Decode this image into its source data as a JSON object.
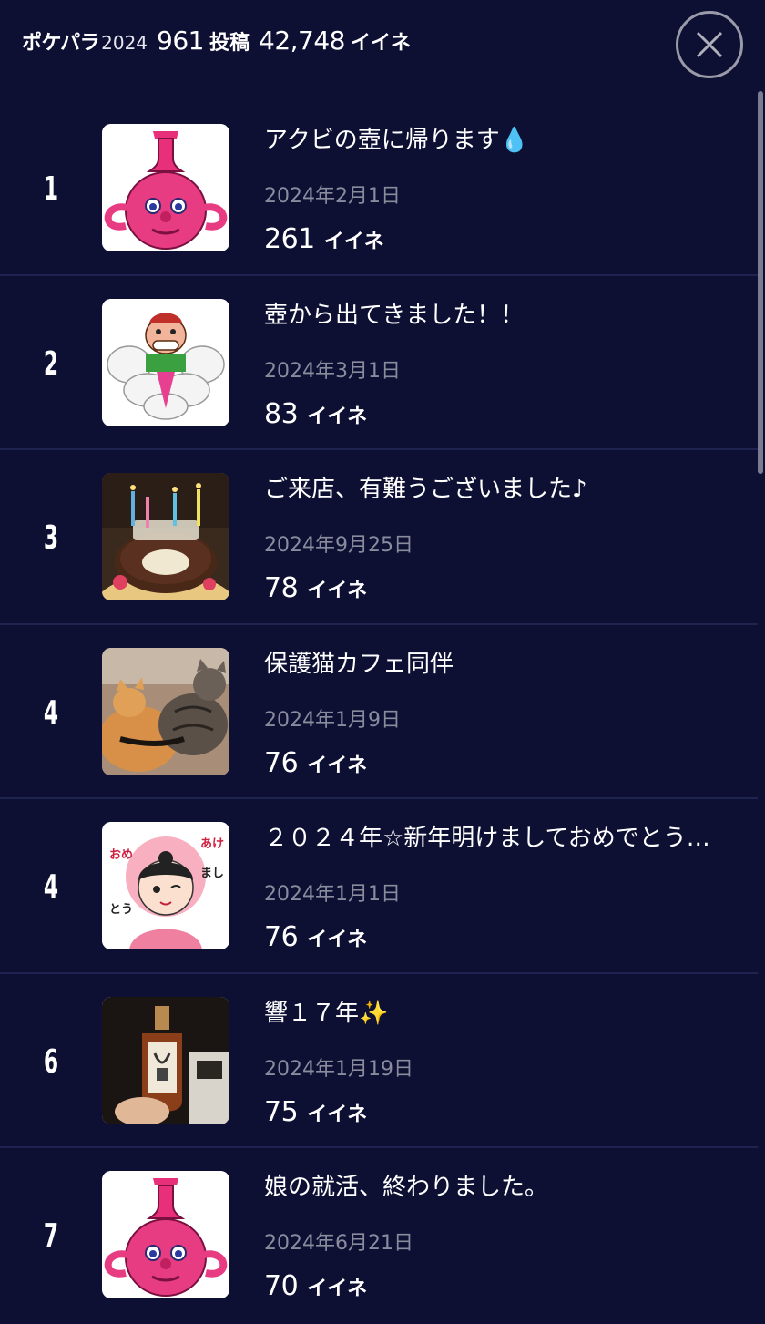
{
  "header": {
    "app_name": "ポケパラ",
    "year": "2024",
    "post_count": "961",
    "post_unit": "投稿",
    "like_count": "42,748",
    "like_unit": "イイネ",
    "close_icon": "close-icon"
  },
  "posts": [
    {
      "rank": "1",
      "title": "アクビの壺に帰ります💧",
      "date": "2024年2月1日",
      "likes": "261",
      "likes_unit": "イイネ",
      "thumb": "pink-jar-character"
    },
    {
      "rank": "2",
      "title": "壺から出てきました！！",
      "date": "2024年3月1日",
      "likes": "83",
      "likes_unit": "イイネ",
      "thumb": "genie-on-cloud"
    },
    {
      "rank": "3",
      "title": "ご来店、有難うございました♪",
      "date": "2024年9月25日",
      "likes": "78",
      "likes_unit": "イイネ",
      "thumb": "birthday-cake-photo"
    },
    {
      "rank": "4",
      "title": "保護猫カフェ同伴",
      "date": "2024年1月9日",
      "likes": "76",
      "likes_unit": "イイネ",
      "thumb": "cats-photo"
    },
    {
      "rank": "4",
      "title": "２０２４年☆新年明けましておめでとう…",
      "date": "2024年1月1日",
      "likes": "76",
      "likes_unit": "イイネ",
      "thumb": "new-year-girl-illustration"
    },
    {
      "rank": "6",
      "title": "響１７年✨",
      "date": "2024年1月19日",
      "likes": "75",
      "likes_unit": "イイネ",
      "thumb": "whisky-bottle-photo"
    },
    {
      "rank": "7",
      "title": "娘の就活、終わりました。",
      "date": "2024年6月21日",
      "likes": "70",
      "likes_unit": "イイネ",
      "thumb": "pink-jar-character"
    }
  ]
}
